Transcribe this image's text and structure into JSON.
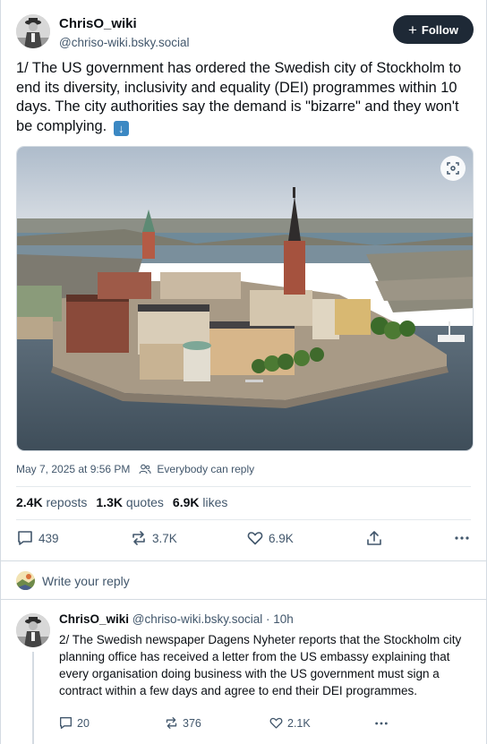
{
  "post": {
    "author_name": "ChrisO_wiki",
    "author_handle": "@chriso-wiki.bsky.social",
    "follow_label": "Follow",
    "text": "1/ The US government has ordered the Swedish city of Stockholm to end its diversity, inclusivity and equality (DEI) programmes within 10 days. The city authorities say the demand is \"bizarre\" and they won't be complying.",
    "emoji_icon": "down-arrow-emoji-icon",
    "timestamp": "May 7, 2025 at 9:56 PM",
    "reply_setting": "Everybody can reply",
    "stats": {
      "reposts_count": "2.4K",
      "reposts_label": "reposts",
      "quotes_count": "1.3K",
      "quotes_label": "quotes",
      "likes_count": "6.9K",
      "likes_label": "likes"
    },
    "actions": {
      "replies": "439",
      "reposts": "3.7K",
      "likes": "6.9K"
    }
  },
  "reply_prompt": "Write your reply",
  "reply_post": {
    "author_name": "ChrisO_wiki",
    "author_handle": "@chriso-wiki.bsky.social",
    "time": "· 10h",
    "text": "2/ The Swedish newspaper Dagens Nyheter reports that the Stockholm city planning office has received a letter from the US embassy explaining that every organisation doing business with the US government must sign a contract within a few days and agree to end their DEI programmes.",
    "actions": {
      "replies": "20",
      "reposts": "376",
      "likes": "2.1K"
    }
  },
  "colors": {
    "text": "#0b0f14",
    "muted": "#42576c",
    "follow_bg": "#1e2936",
    "border": "#d4dbe2"
  }
}
